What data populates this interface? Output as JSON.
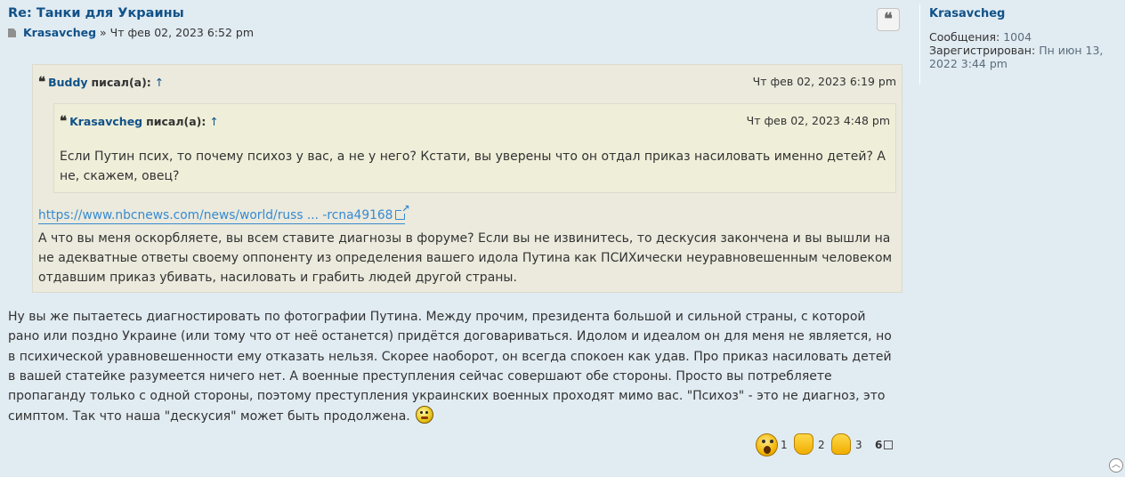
{
  "post": {
    "title": "Re: Танки для Украины",
    "author": "Krasavcheg",
    "separator": "»",
    "date": "Чт фев 02, 2023 6:52 pm"
  },
  "quote_outer": {
    "author": "Buddy",
    "wrote": "писал(а):",
    "arrow": "↑",
    "date": "Чт фев 02, 2023 6:19 pm",
    "link_text": "https://www.nbcnews.com/news/world/russ ... -rcna49168",
    "text": "А что вы меня оскорбляете, вы всем ставите диагнозы в форуме? Если вы не извинитесь, то дескусия закончена и вы вышли на не адекватные ответы своему оппоненту из определения вашего идола Путина как ПСИХически неуравновешенным человеком отдавшим приказ убивать, насиловать и грабить людей другой страны."
  },
  "quote_inner": {
    "author": "Krasavcheg",
    "wrote": "писал(а):",
    "arrow": "↑",
    "date": "Чт фев 02, 2023 4:48 pm",
    "text": "Если Путин псих, то почему психоз у вас, а не у него? Кстати, вы уверены что он отдал приказ насиловать именно детей? А не, скажем, овец?"
  },
  "body_text": "Ну вы же пытаетесь диагностировать по фотографии Путина. Между прочим, президента большой и сильной страны, с которой рано или поздно Украине (или тому что от неё останется) придётся договариваться. Идолом и идеалом он для меня не является, но в психической уравновешенности ему отказать нельзя. Скорее наоборот, он всегда спокоен как удав. Про приказ насиловать детей в вашей статейке разумеется ничего нет. А военные преступления сейчас совершают обе стороны. Просто вы потребляете пропаганду только с одной стороны, поэтому преступления украинских военных проходят мимо вас. \"Психоз\" - это не диагноз, это симптом. Так что наша \"дескусия\" может быть продолжена.",
  "reactions": [
    {
      "icon": "shocked-face-icon",
      "count": "1"
    },
    {
      "icon": "thumbs-down-icon",
      "count": "2"
    },
    {
      "icon": "thumbs-up-icon",
      "count": "3"
    }
  ],
  "reactions_total": "6",
  "profile": {
    "name": "Krasavcheg",
    "posts_label": "Сообщения:",
    "posts_value": "1004",
    "registered_label": "Зарегистрирован:",
    "registered_value": "Пн июн 13, 2022 3:44 pm"
  },
  "colors": {
    "background": "#e1ebf2",
    "link": "#105289",
    "external_link": "#368ad2",
    "quote_bg": "#ebeadd"
  }
}
